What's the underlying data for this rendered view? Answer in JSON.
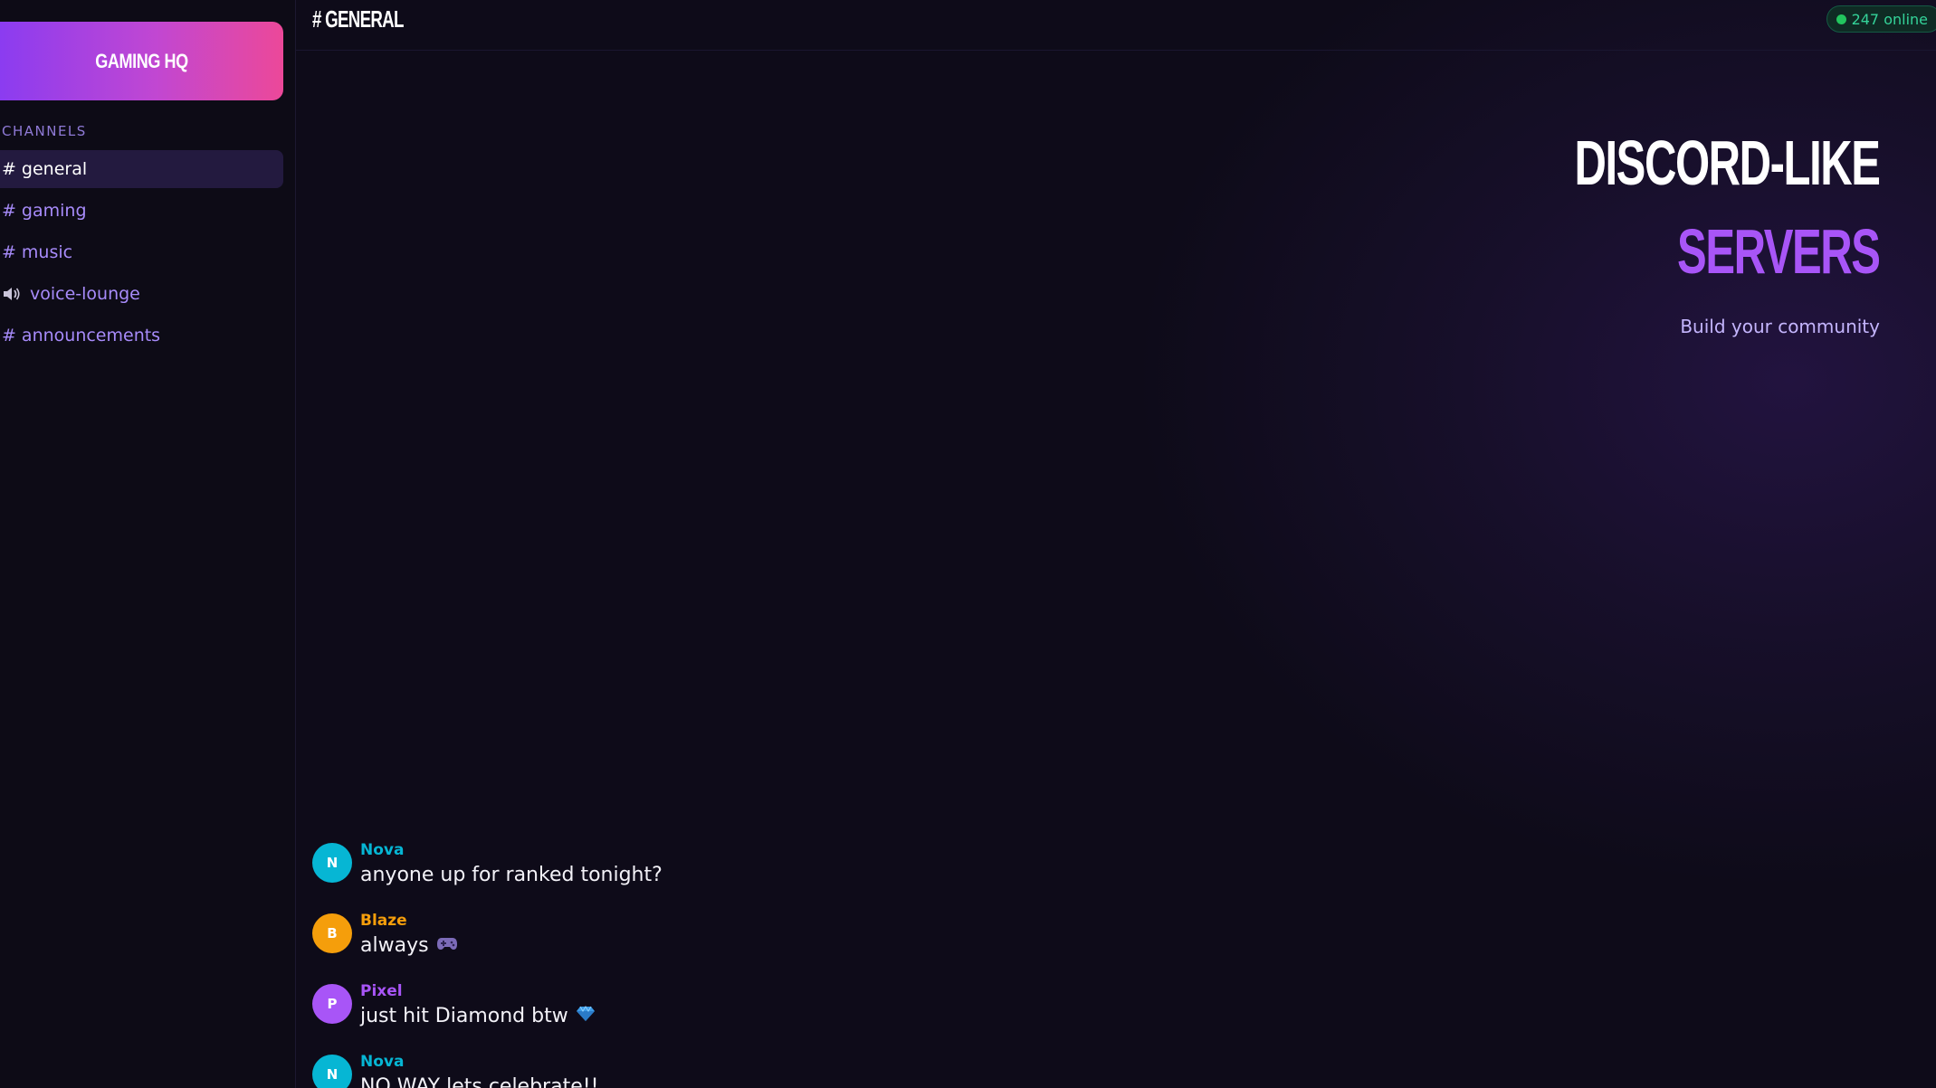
{
  "server": {
    "name": "GAMING HQ"
  },
  "sidebar": {
    "channels_header": "CHANNELS",
    "channels": [
      {
        "prefix": "#",
        "label": "general",
        "type": "text",
        "active": true
      },
      {
        "prefix": "#",
        "label": "gaming",
        "type": "text",
        "active": false
      },
      {
        "prefix": "#",
        "label": "music",
        "type": "text",
        "active": false
      },
      {
        "prefix": "",
        "label": "voice-lounge",
        "type": "voice",
        "icon": "speaker-icon",
        "active": false
      },
      {
        "prefix": "#",
        "label": "announcements",
        "type": "text",
        "active": false
      }
    ]
  },
  "header": {
    "channel_title": "# GENERAL",
    "online_text": "247 online"
  },
  "hero": {
    "line1": "DISCORD-LIKE",
    "line2": "SERVERS",
    "subtitle": "Build your community"
  },
  "messages": [
    {
      "initial": "N",
      "author": "Nova",
      "text": "anyone up for ranked tonight?",
      "color": "#06b6d4"
    },
    {
      "initial": "B",
      "author": "Blaze",
      "text": "always",
      "emoji": "game-controller-icon",
      "color": "#f59e0b"
    },
    {
      "initial": "P",
      "author": "Pixel",
      "text": "just hit Diamond btw",
      "emoji": "gem-icon",
      "color": "#a855f7"
    },
    {
      "initial": "N",
      "author": "Nova",
      "text": "NO WAY lets celebrate!!",
      "color": "#06b6d4"
    }
  ],
  "colors": {
    "accent": "#a855f7",
    "online": "#22c55e",
    "nova": "#06b6d4",
    "blaze": "#f59e0b",
    "pixel": "#a855f7"
  }
}
